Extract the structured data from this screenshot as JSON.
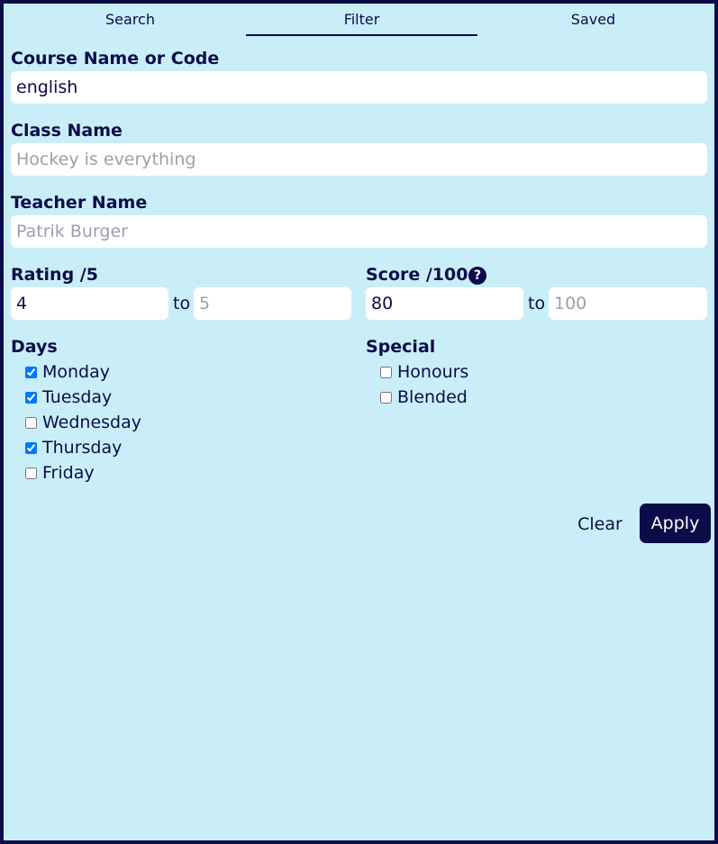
{
  "tabs": {
    "search": "Search",
    "filter": "Filter",
    "saved": "Saved"
  },
  "course": {
    "label": "Course Name or Code",
    "value": "english",
    "placeholder": ""
  },
  "class_name": {
    "label": "Class Name",
    "value": "",
    "placeholder": "Hockey is everything"
  },
  "teacher": {
    "label": "Teacher Name",
    "value": "",
    "placeholder": "Patrik Burger"
  },
  "rating": {
    "label": "Rating /5",
    "min_value": "4",
    "max_value": "",
    "max_placeholder": "5",
    "to": "to"
  },
  "score": {
    "label": "Score /100",
    "help_icon": "?",
    "min_value": "80",
    "max_value": "",
    "max_placeholder": "100",
    "to": "to"
  },
  "days": {
    "label": "Days",
    "items": [
      {
        "label": "Monday",
        "checked": true
      },
      {
        "label": "Tuesday",
        "checked": true
      },
      {
        "label": "Wednesday",
        "checked": false
      },
      {
        "label": "Thursday",
        "checked": true
      },
      {
        "label": "Friday",
        "checked": false
      }
    ]
  },
  "special": {
    "label": "Special",
    "items": [
      {
        "label": "Honours",
        "checked": false
      },
      {
        "label": "Blended",
        "checked": false
      }
    ]
  },
  "actions": {
    "clear": "Clear",
    "apply": "Apply"
  },
  "colors": {
    "background": "#c9eef7",
    "accent": "#0c0c4a",
    "field": "#ffffff"
  }
}
